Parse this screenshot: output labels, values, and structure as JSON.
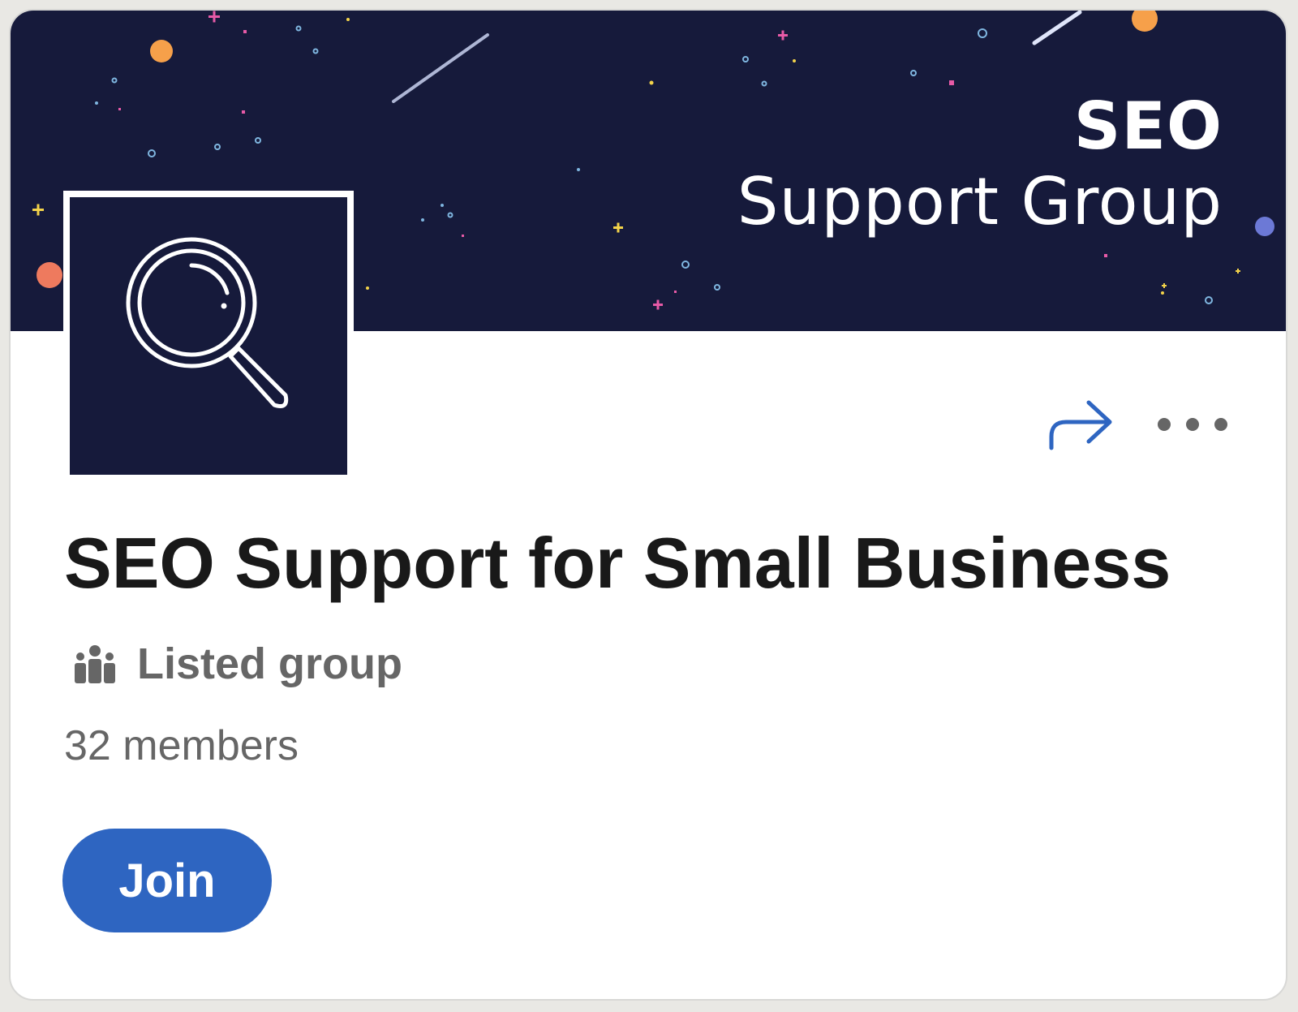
{
  "banner": {
    "title_line1": "SEO",
    "title_line2": "Support  Group",
    "background_color": "#161a3b"
  },
  "logo": {
    "icon": "magnifying-glass-icon"
  },
  "actions": {
    "share_icon": "share-arrow-icon",
    "more_icon": "more-options-icon"
  },
  "group": {
    "name": "SEO Support for Small Business",
    "type_icon": "group-people-icon",
    "type_label": "Listed group",
    "members": "32 members"
  },
  "join_button": {
    "label": "Join",
    "color": "#2e65c1"
  },
  "colors": {
    "accent": "#2e65c1",
    "text_primary": "#191919",
    "text_secondary": "#666666"
  }
}
